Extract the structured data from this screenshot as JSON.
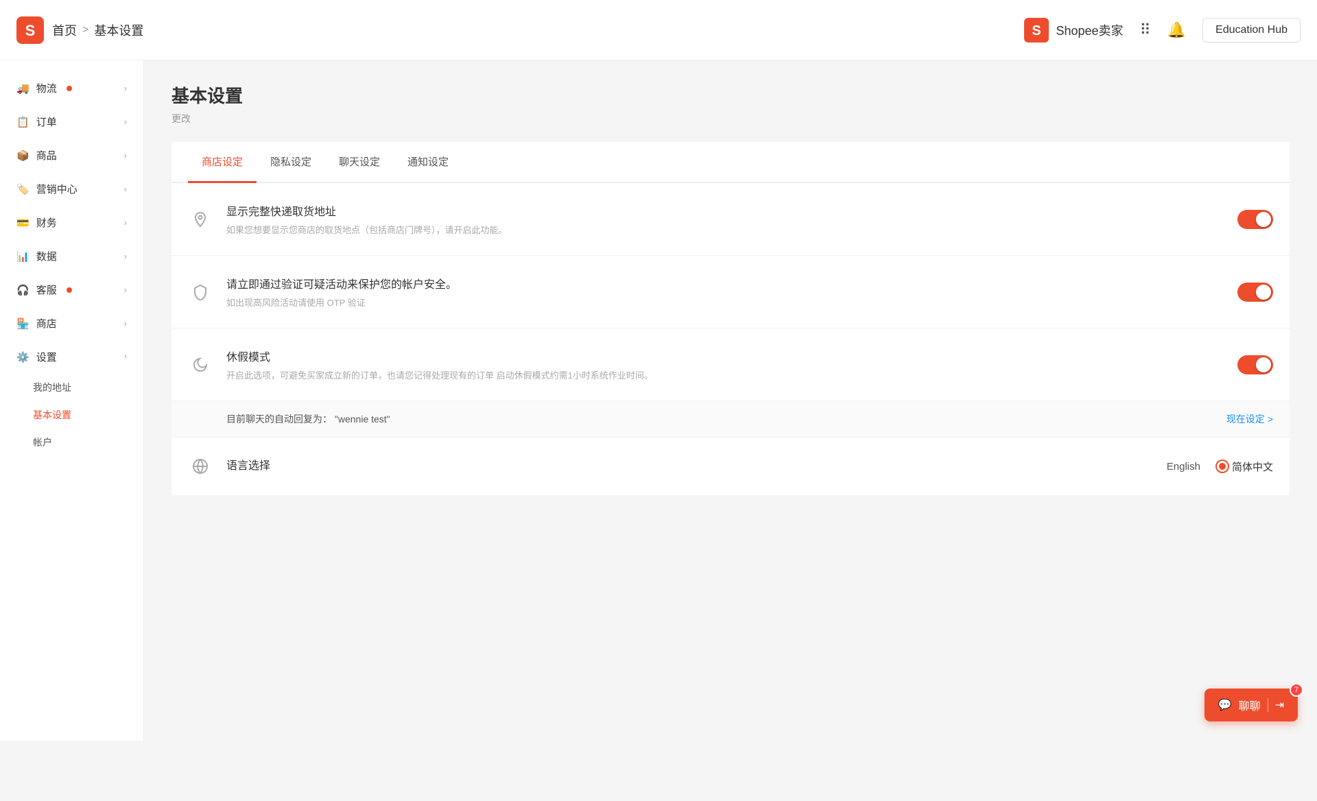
{
  "header": {
    "home_label": "首页",
    "separator": ">",
    "current_page": "基本设置",
    "seller_name": "Shopee卖家",
    "education_hub": "Education Hub"
  },
  "sidebar": {
    "items": [
      {
        "icon": "🚚",
        "label": "物流",
        "has_dot": true,
        "expanded": false
      },
      {
        "icon": "📋",
        "label": "订单",
        "has_dot": false,
        "expanded": false
      },
      {
        "icon": "📦",
        "label": "商品",
        "has_dot": false,
        "expanded": false
      },
      {
        "icon": "🏷️",
        "label": "营销中心",
        "has_dot": false,
        "expanded": false
      },
      {
        "icon": "💰",
        "label": "财务",
        "has_dot": false,
        "expanded": false
      },
      {
        "icon": "📊",
        "label": "数据",
        "has_dot": false,
        "expanded": false
      },
      {
        "icon": "🎧",
        "label": "客服",
        "has_dot": true,
        "expanded": false
      },
      {
        "icon": "🏪",
        "label": "商店",
        "has_dot": false,
        "expanded": false
      },
      {
        "icon": "⚙️",
        "label": "设置",
        "has_dot": false,
        "expanded": true
      }
    ],
    "settings_sub": [
      {
        "label": "我的地址",
        "active": false
      },
      {
        "label": "基本设置",
        "active": true
      },
      {
        "label": "帐户",
        "active": false
      }
    ]
  },
  "main": {
    "page_title": "基本设置",
    "page_subtitle": "更改",
    "tabs": [
      {
        "label": "商店设定",
        "active": true
      },
      {
        "label": "隐私设定",
        "active": false
      },
      {
        "label": "聊天设定",
        "active": false
      },
      {
        "label": "通知设定",
        "active": false
      }
    ],
    "settings": [
      {
        "icon": "📍",
        "title": "显示完整快递取货地址",
        "desc": "如果您想要显示您商店的取货地点（包括商店门牌号），请开启此功能。",
        "toggle": true
      },
      {
        "icon": "🛡️",
        "title": "请立即通过验证可疑活动来保护您的帐户安全。",
        "desc": "如出现高风险活动请使用 OTP 验证",
        "toggle": true
      },
      {
        "icon": "🌙",
        "title": "休假模式",
        "desc": "开启此选项，可避免买家成立新的订单，也请您记得处理现有的订单 启动休假模式约需1小时系统作业时间。",
        "toggle": true
      }
    ],
    "auto_reply": {
      "label": "目前聊天的自动回复为：",
      "value": "\"wennie test\"",
      "link_label": "现在设定",
      "link_arrow": ">"
    },
    "language": {
      "icon": "🌐",
      "title": "语言选择",
      "options": [
        {
          "label": "English",
          "selected": false
        },
        {
          "label": "简体中文",
          "selected": true
        }
      ]
    }
  },
  "chat": {
    "label": "聊聊",
    "badge": "7"
  }
}
